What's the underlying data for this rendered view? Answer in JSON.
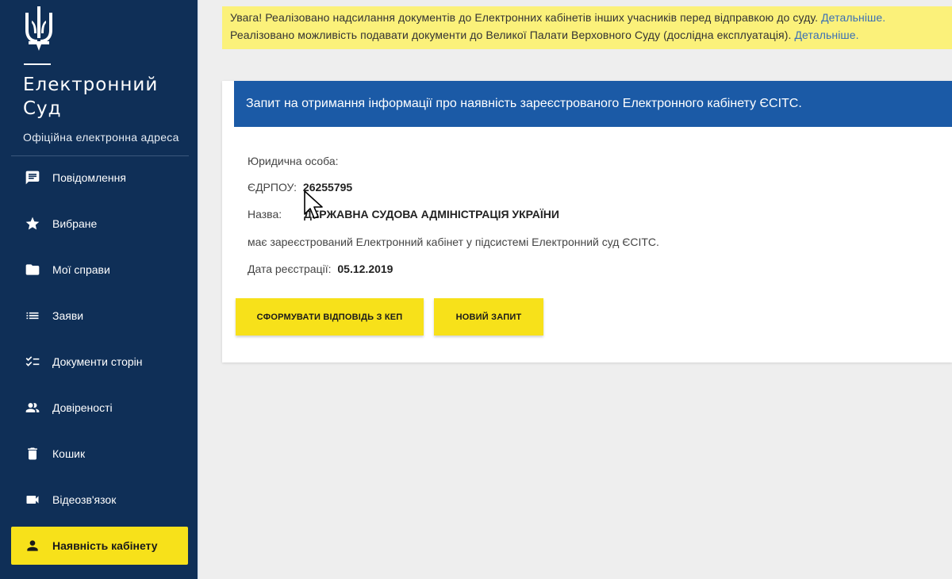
{
  "sidebar": {
    "title_line1": "Електронний",
    "title_line2": "Суд",
    "subtitle": "Офіційна електронна адреса",
    "items": [
      {
        "label": "Повідомлення",
        "icon": "message-icon"
      },
      {
        "label": "Вибране",
        "icon": "star-icon"
      },
      {
        "label": "Мої справи",
        "icon": "folder-icon"
      },
      {
        "label": "Заяви",
        "icon": "list-icon"
      },
      {
        "label": "Документи сторін",
        "icon": "checklist-icon"
      },
      {
        "label": "Довіреності",
        "icon": "people-icon"
      },
      {
        "label": "Кошик",
        "icon": "trash-icon"
      },
      {
        "label": "Відеозв'язок",
        "icon": "video-camera-icon"
      },
      {
        "label": "Наявність кабінету",
        "icon": "person-icon",
        "active": true
      }
    ]
  },
  "notice": {
    "line1_text": "Увага! Реалізовано надсилання документів до Електронних кабінетів інших учасників перед відправкою до суду. ",
    "line1_link": "Детальніше.",
    "line2_text": "Реалізовано можливість подавати документи до Великої Палати Верховного Суду (дослідна експлуатація). ",
    "line2_link": "Детальніше."
  },
  "card": {
    "header": "Запит на отримання інформації про наявність зареєстрованого Електронного кабінету ЄСІТС.",
    "entity_type": "Юридична особа:",
    "edrpou_label": "ЄДРПОУ:",
    "edrpou_value": "26255795",
    "name_label": "Назва:",
    "name_value": "ДЕРЖАВНА СУДОВА АДМІНІСТРАЦІЯ УКРАЇНИ",
    "status_text": "має зареєстрований Електронний кабінет у підсистемі Електронний суд ЄСІТС.",
    "date_label": "Дата реєстрації:",
    "date_value": "05.12.2019",
    "btn_sign": "СФОРМУВАТИ ВІДПОВІДЬ З КЕП",
    "btn_new": "НОВИЙ ЗАПИТ"
  },
  "colors": {
    "sidebar_bg": "#0f2f57",
    "accent_yellow": "#f7e11a",
    "header_blue": "#1b5aa6",
    "notice_bg": "#fbf17a",
    "link": "#3a6fb6"
  }
}
